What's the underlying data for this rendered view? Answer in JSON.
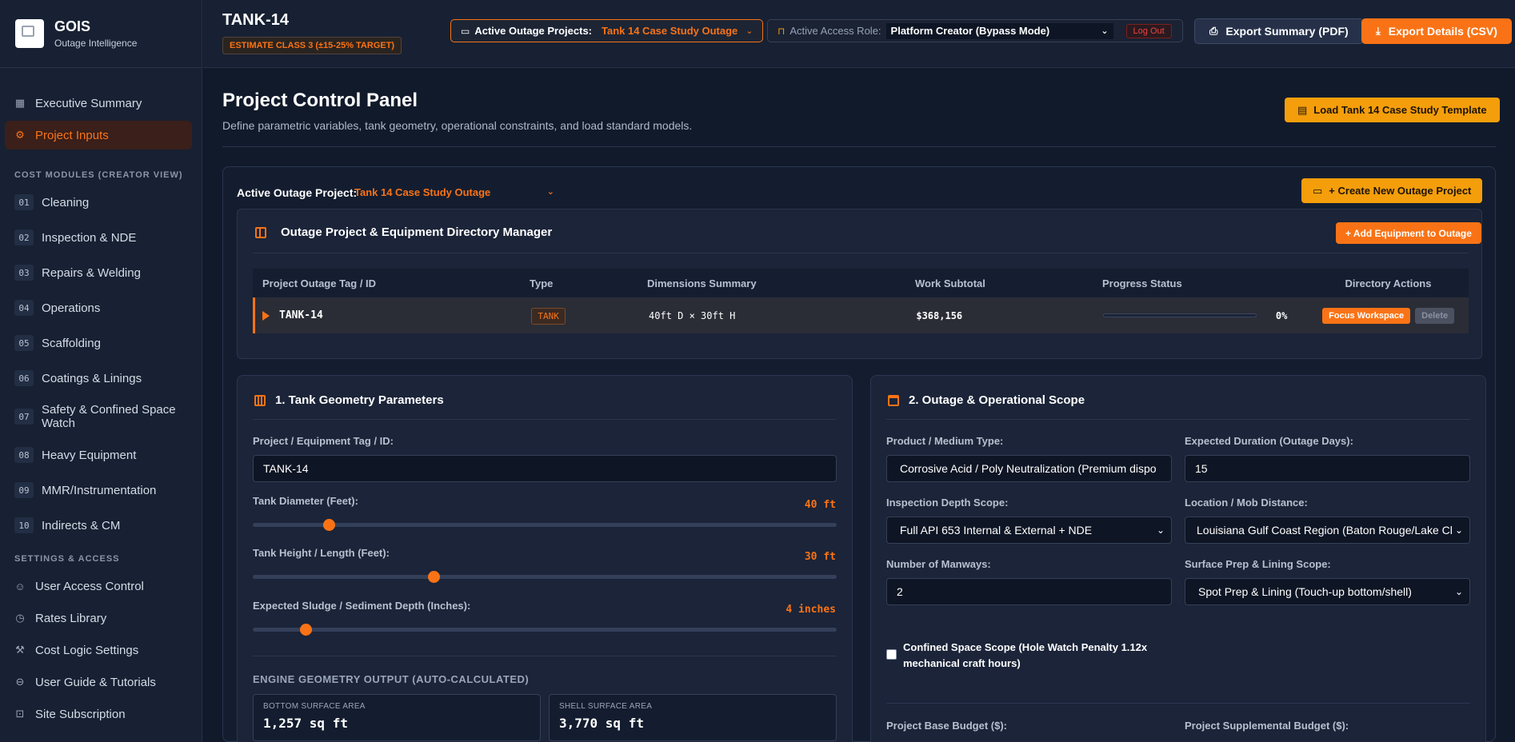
{
  "brand": {
    "title": "GOIS",
    "subtitle": "Outage Intelligence"
  },
  "nav": {
    "executive_summary": "Executive Summary",
    "project_inputs": "Project Inputs",
    "modules_heading": "COST MODULES (CREATOR VIEW)",
    "modules": [
      {
        "num": "01",
        "label": "Cleaning"
      },
      {
        "num": "02",
        "label": "Inspection & NDE"
      },
      {
        "num": "03",
        "label": "Repairs & Welding"
      },
      {
        "num": "04",
        "label": "Operations"
      },
      {
        "num": "05",
        "label": "Scaffolding"
      },
      {
        "num": "06",
        "label": "Coatings & Linings"
      },
      {
        "num": "07",
        "label": "Safety & Confined Space Watch"
      },
      {
        "num": "08",
        "label": "Heavy Equipment"
      },
      {
        "num": "09",
        "label": "MMR/Instrumentation"
      },
      {
        "num": "10",
        "label": "Indirects & CM"
      }
    ],
    "settings_heading": "SETTINGS & ACCESS",
    "settings": [
      {
        "label": "User Access Control",
        "icon": "users-icon"
      },
      {
        "label": "Rates Library",
        "icon": "clock-icon"
      },
      {
        "label": "Cost Logic Settings",
        "icon": "wrench-icon"
      },
      {
        "label": "User Guide & Tutorials",
        "icon": "book-icon"
      },
      {
        "label": "Site Subscription",
        "icon": "lock-icon"
      }
    ]
  },
  "topbar": {
    "title": "TANK-14",
    "estimate_badge": "ESTIMATE CLASS 3 (±15-25% TARGET)",
    "active_projects_label": "Active Outage Projects:",
    "active_project_value": "Tank 14 Case Study Outage",
    "role_label": "Active Access Role:",
    "role_value": "Platform Creator (Bypass Mode)",
    "logout": "Log Out",
    "export_pdf": "Export Summary (PDF)",
    "export_csv": "Export Details (CSV)"
  },
  "main": {
    "title": "Project Control Panel",
    "subtitle": "Define parametric variables, tank geometry, operational constraints, and load standard models.",
    "load_template": "Load Tank 14 Case Study Template",
    "active_outage_label": "Active Outage Project:",
    "active_outage_value": "Tank 14 Case Study Outage",
    "create_project": "+ Create New Outage Project"
  },
  "directory": {
    "title": "Outage Project & Equipment Directory Manager",
    "add_equipment": "+ Add Equipment to Outage",
    "headers": [
      "Project Outage Tag / ID",
      "Type",
      "Dimensions Summary",
      "Work Subtotal",
      "Progress Status",
      "Directory Actions"
    ],
    "row": {
      "tag": "TANK-14",
      "type": "TANK",
      "dimensions": "40ft D × 30ft H",
      "subtotal": "$368,156",
      "progress_pct": "0%",
      "progress_value": 0,
      "focus": "Focus Workspace",
      "delete": "Delete"
    }
  },
  "geometry": {
    "title": "1. Tank Geometry Parameters",
    "tag_label": "Project / Equipment Tag / ID:",
    "tag_value": "TANK-14",
    "diameter_label": "Tank Diameter (Feet):",
    "diameter_value": "40 ft",
    "diameter_fraction": 0.13,
    "height_label": "Tank Height / Length (Feet):",
    "height_value": "30 ft",
    "height_fraction": 0.31,
    "sludge_label": "Expected Sludge / Sediment Depth (Inches):",
    "sludge_value": "4 inches",
    "sludge_fraction": 0.09,
    "engine_title": "ENGINE GEOMETRY OUTPUT (AUTO-CALCULATED)",
    "bottom_area_label": "BOTTOM SURFACE AREA",
    "bottom_area_value": "1,257 sq ft",
    "shell_area_label": "SHELL SURFACE AREA",
    "shell_area_value": "3,770 sq ft"
  },
  "scope": {
    "title": "2. Outage & Operational Scope",
    "product_label": "Product / Medium Type:",
    "product_value": "Corrosive Acid / Poly Neutralization (Premium disposal)",
    "duration_label": "Expected Duration (Outage Days):",
    "duration_value": "15",
    "inspection_label": "Inspection Depth Scope:",
    "inspection_value": "Full API 653 Internal & External + NDE",
    "location_label": "Location / Mob Distance:",
    "location_value": "Louisiana Gulf Coast Region (Baton Rouge/Lake Charles)",
    "manways_label": "Number of Manways:",
    "manways_value": "2",
    "surface_label": "Surface Prep & Lining Scope:",
    "surface_value": "Spot Prep & Lining (Touch-up bottom/shell)",
    "confined_label": "Confined Space Scope (Hole Watch Penalty 1.12x mechanical craft hours)",
    "base_budget_label": "Project Base Budget ($):",
    "supp_budget_label": "Project Supplemental Budget ($):"
  },
  "colors": {
    "accent": "#f97316",
    "amber": "#f59e0b",
    "background": "#111a2b",
    "panel": "#1b2438"
  }
}
